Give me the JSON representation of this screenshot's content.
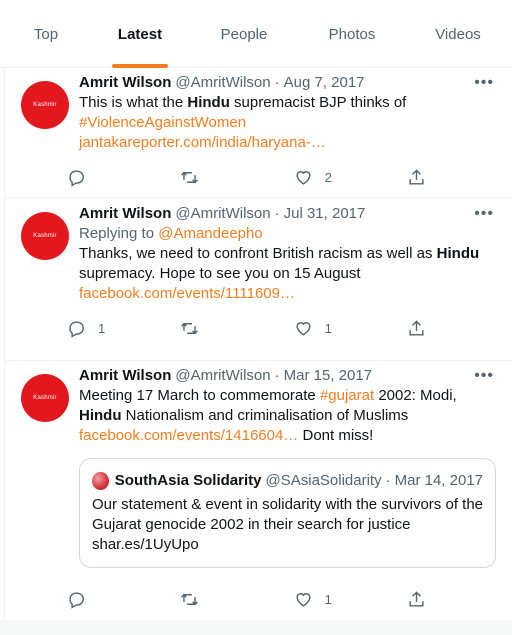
{
  "tabs": [
    {
      "label": "Top"
    },
    {
      "label": "Latest"
    },
    {
      "label": "People"
    },
    {
      "label": "Photos"
    },
    {
      "label": "Videos"
    }
  ],
  "active_tab": "Latest",
  "accent_color": "#f47d1f",
  "avatar_text": "Kashmir",
  "tweets": [
    {
      "name": "Amrit Wilson",
      "handle": "@AmritWilson",
      "separator": "·",
      "date": "Aug 7, 2017",
      "text_1": "This is what the ",
      "bold_1": "Hindu",
      "text_2": " supremacist BJP thinks of",
      "hashtag": "#ViolenceAgainstWomen",
      "link": "jantakareporter.com/india/haryana-…",
      "replies": "",
      "retweets": "",
      "likes": "2"
    },
    {
      "name": "Amrit Wilson",
      "handle": "@AmritWilson",
      "separator": "·",
      "date": "Jul 31, 2017",
      "replying_prefix": "Replying to ",
      "replying_to": "@Amandeepho",
      "text_1": "Thanks, we need to confront British racism as well as ",
      "bold_1": "Hindu",
      "text_2": " supremacy. Hope to see you on 15 August",
      "link": "facebook.com/events/1111609…",
      "replies": "1",
      "retweets": "",
      "likes": "1"
    },
    {
      "name": "Amrit Wilson",
      "handle": "@AmritWilson",
      "separator": "·",
      "date": "Mar 15, 2017",
      "text_1": "Meeting 17 March to commemorate ",
      "hashtag": "#gujarat",
      "text_2": " 2002: Modi,",
      "bold_1": "Hindu",
      "text_3": " Nationalism and criminalisation of Muslims",
      "link": "facebook.com/events/1416604…",
      "text_4": " Dont miss!",
      "replies": "",
      "retweets": "",
      "likes": "1",
      "quote": {
        "name": "SouthAsia Solidarity",
        "handle": "@SAsiaSolidarity",
        "separator": "·",
        "date": "Mar 14, 2017",
        "text": "Our statement & event in solidarity with the survivors of the Gujarat genocide 2002 in their search for justice shar.es/1UyUpo"
      }
    }
  ],
  "icons": [
    "reply-icon",
    "retweet-icon",
    "like-icon",
    "share-icon",
    "more-icon"
  ]
}
